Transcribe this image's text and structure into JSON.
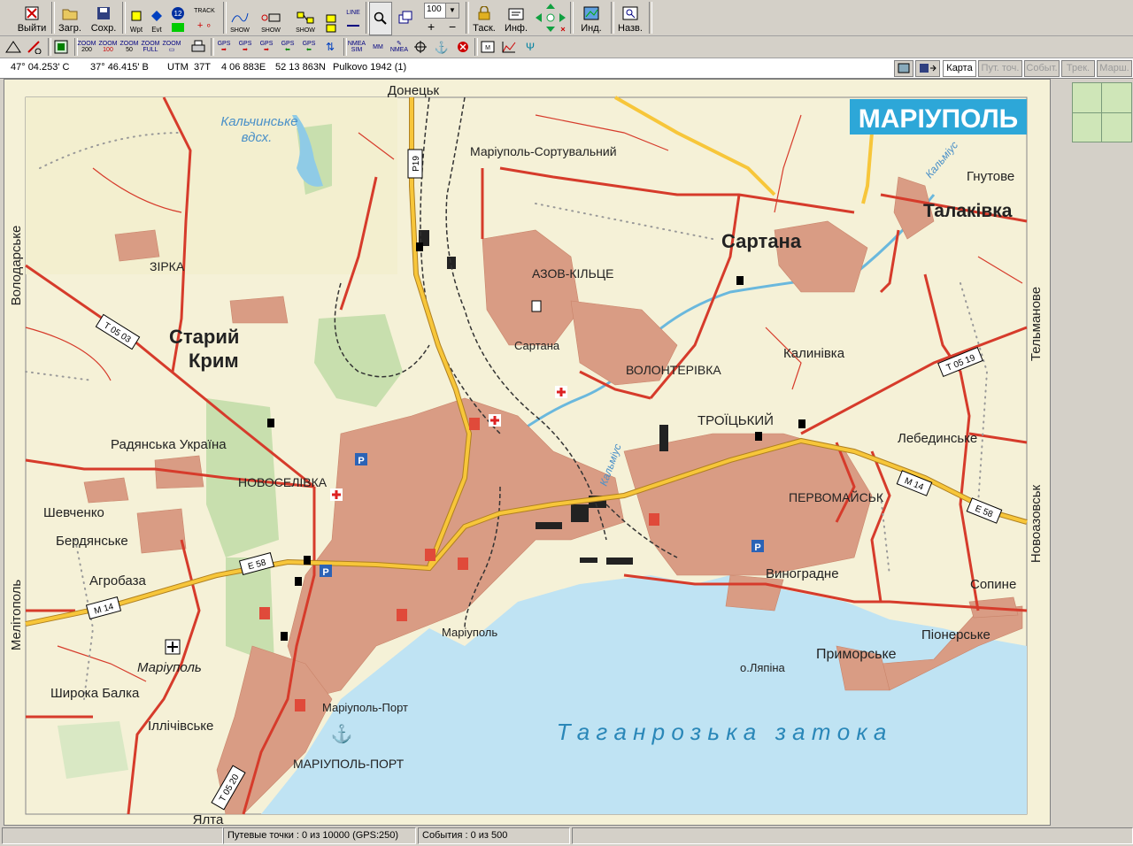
{
  "toolbar1": {
    "exit": "Выйти",
    "load": "Загр.",
    "save": "Сохр.",
    "wpt": "Wpt",
    "evt": "Evt",
    "track": "TRACK",
    "show1": "SHOW",
    "show2": "SHOW",
    "show3": "SHOW",
    "line": "LINE",
    "zoom_value": "100",
    "tasks": "Таск.",
    "info": "Инф.",
    "index": "Инд.",
    "names": "Назв."
  },
  "toolbar2": {
    "zooms": [
      {
        "top": "ZOOM",
        "bottom": "200"
      },
      {
        "top": "ZOOM",
        "bottom": "100"
      },
      {
        "top": "ZOOM",
        "bottom": "50"
      },
      {
        "top": "ZOOM",
        "bottom": "FULL"
      },
      {
        "top": "ZOOM",
        "bottom": ""
      }
    ],
    "gps": [
      "GPS",
      "GPS",
      "GPS",
      "GPS",
      "GPS"
    ],
    "nmea_sim": "NMEA SIM",
    "mm": "MM",
    "nmea": "NMEA"
  },
  "coords": {
    "lon": "47° 04.253' С",
    "lat": "37° 46.415' В",
    "utm_label": "UTM",
    "zone": "37T",
    "easting": "4 06 883E",
    "northing": "52 13 863N",
    "datum": "Pulkovo 1942 (1)"
  },
  "map_tabs": [
    {
      "label": "Карта",
      "enabled": true
    },
    {
      "label": "Пут. точ.",
      "enabled": false
    },
    {
      "label": "Событ.",
      "enabled": false
    },
    {
      "label": "Трек.",
      "enabled": false
    },
    {
      "label": "Марш.",
      "enabled": false
    }
  ],
  "map": {
    "title": "МАРІУПОЛЬ",
    "colors": {
      "land": "#f5f1d7",
      "sea": "#bfe3f3",
      "town": "#d99c84",
      "road": "#d63b2b",
      "highway": "#f7c63a",
      "park": "#c8dfae",
      "title_bg": "#2da7d8"
    },
    "border_labels": {
      "top": "Донецьк",
      "bottom": "Ялта",
      "left_top": "Володарське",
      "left_bottom": "Мелітополь",
      "right_top": "Тельманове",
      "right_bottom": "Новоазовськ"
    },
    "places": {
      "kalchyk_res": "Кальчинське",
      "kalchyk_res2": "вдсх.",
      "sort": "Маріуполь-Сортувальний",
      "hnutove": "Гнутове",
      "talakivka": "Талаківка",
      "sartana_big": "Сартана",
      "zirka": "ЗІРКА",
      "azov": "АЗОВ-КІЛЬЦЕ",
      "staryi": "Старий",
      "krym": "Крим",
      "sartana_st": "Сартана",
      "kalynivka": "Калинівка",
      "volont": "ВОЛОНТЕРІВКА",
      "troitsky": "ТРОЇЦЬКИЙ",
      "lebed": "Лебединське",
      "radyanska": "Радянська Україна",
      "novosel": "НОВОСЕЛІВКА",
      "pervomaysk": "ПЕРВОМАЙСЬК",
      "shevchenko": "Шевченко",
      "berd": "Бердянське",
      "agrobaza": "Агробаза",
      "vynohradne": "Виноградне",
      "sopyne": "Сопине",
      "mariupol_st": "Маріуполь",
      "pionerske": "Піонерське",
      "prymorske": "Приморське",
      "airport": "Маріуполь",
      "lyapina": "о.Ляпіна",
      "shyroka": "Широка Балка",
      "illich": "Іллічівське",
      "port_st": "Маріуполь-Порт",
      "port_dist": "МАРІУПОЛЬ-ПОРТ",
      "gulf": "Т а г а н р о з ь к а   з а т о к а",
      "kalmius": "Кальміус",
      "kalmius2": "Кальміус"
    },
    "road_shields": [
      "Р19",
      "Т 05 03",
      "Т 05 19",
      "М 14",
      "Е 58",
      "Е 58",
      "М 14",
      "Т 05 20"
    ]
  },
  "status": {
    "waypoints": "Путевые точки : 0 из 10000  (GPS:250)",
    "events": "События : 0 из 500"
  }
}
